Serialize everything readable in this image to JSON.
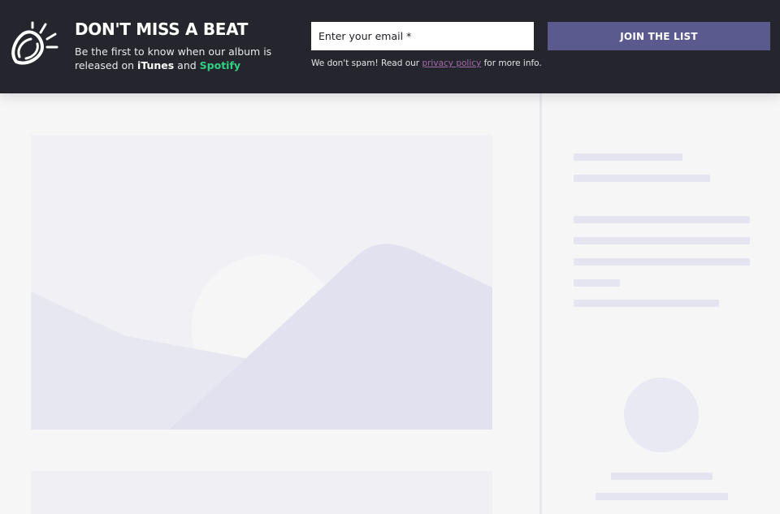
{
  "banner": {
    "headline": "DON'T MISS A BEAT",
    "subtext_prefix": "Be the first to know when our album is released on ",
    "itunes": "iTunes",
    "subtext_and": " and ",
    "spotify": "Spotify",
    "email_placeholder": "Enter your email *",
    "join_label": "JOIN THE LIST",
    "disclaimer_prefix": "We don't spam! Read our ",
    "privacy_link": "privacy policy",
    "disclaimer_suffix": " for more info.",
    "icon": "megaphone-icon",
    "colors": {
      "background": "#25262d",
      "button": "#5a5a8f",
      "spotify": "#2fd184",
      "link": "#a36aa8"
    }
  },
  "content": {
    "hero_icon": "image-placeholder-icon",
    "skeleton_color": "#e4e5f0"
  }
}
